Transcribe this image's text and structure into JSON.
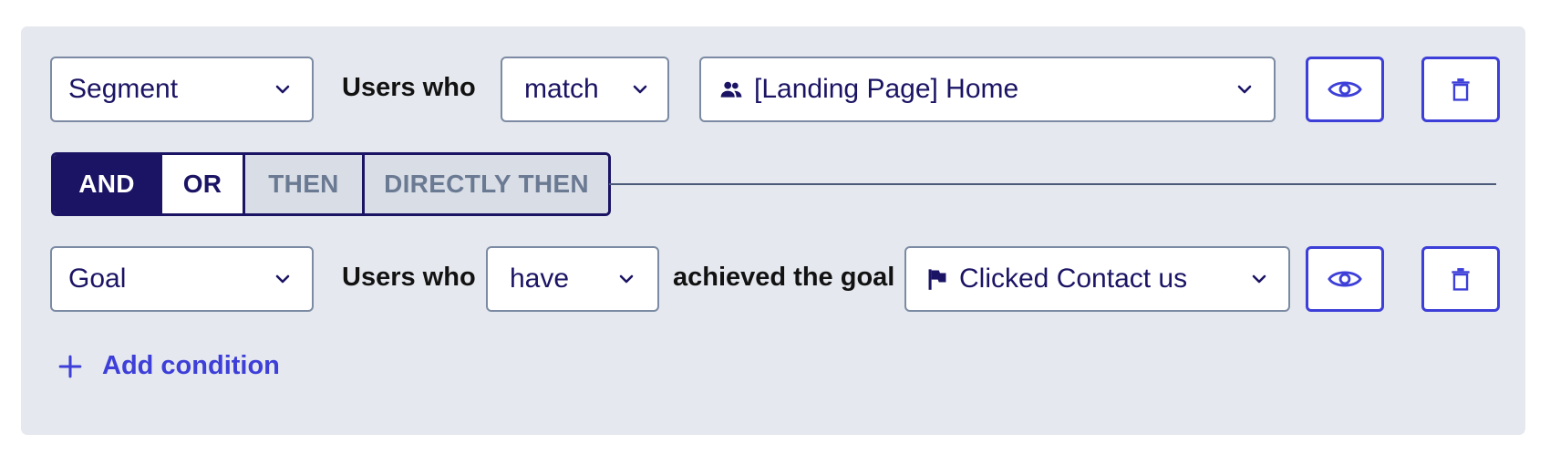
{
  "condition_1": {
    "type_select": "Segment",
    "users_who_label": "Users who",
    "operator_select": "match",
    "value_select": "[Landing Page] Home",
    "value_icon": "users-icon",
    "preview_icon": "eye-icon",
    "delete_icon": "trash-icon"
  },
  "connector": {
    "options": [
      "AND",
      "OR",
      "THEN",
      "DIRECTLY THEN"
    ],
    "selected": "AND"
  },
  "condition_2": {
    "type_select": "Goal",
    "users_who_label": "Users who",
    "operator_select": "have",
    "middle_label": "achieved the goal",
    "value_select": "Clicked Contact us",
    "value_icon": "flag-icon",
    "preview_icon": "eye-icon",
    "delete_icon": "trash-icon"
  },
  "add_condition_label": "Add condition",
  "colors": {
    "accent": "#3d3fd8",
    "navy": "#1b1464",
    "panel_bg": "#e5e8ee",
    "inactive_text": "#6b7a93"
  }
}
